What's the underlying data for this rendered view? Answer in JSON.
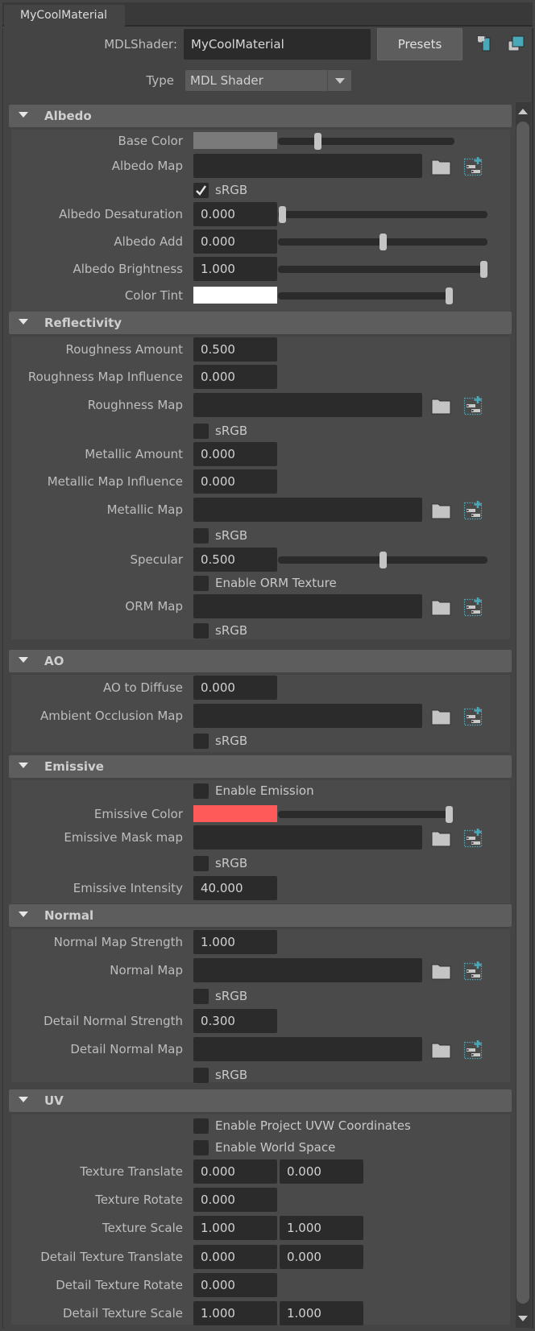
{
  "tab": {
    "label": "MyCoolMaterial"
  },
  "header": {
    "shader_label": "MDLShader:",
    "shader_name": "MyCoolMaterial",
    "presets_label": "Presets",
    "type_label": "Type",
    "type_value": "MDL Shader",
    "icons": [
      "show-input-output-icon",
      "copy-tab-icon"
    ]
  },
  "colors": {
    "accent": "#4aa9b8",
    "base_color": "#7a7a7a",
    "color_tint": "#ffffff",
    "emissive_color": "#ff5a5a"
  },
  "sections": {
    "albedo": {
      "title": "Albedo",
      "base_color": {
        "label": "Base Color",
        "slider": 0.21
      },
      "albedo_map": {
        "label": "Albedo Map",
        "value": ""
      },
      "albedo_srgb": {
        "label": "sRGB",
        "checked": true
      },
      "albedo_desaturation": {
        "label": "Albedo Desaturation",
        "value": "0.000",
        "slider": 0.0
      },
      "albedo_add": {
        "label": "Albedo Add",
        "value": "0.000",
        "slider": 0.5
      },
      "albedo_brightness": {
        "label": "Albedo Brightness",
        "value": "1.000",
        "slider": 1.0
      },
      "color_tint": {
        "label": "Color Tint",
        "slider": 1.0
      }
    },
    "reflectivity": {
      "title": "Reflectivity",
      "roughness_amount": {
        "label": "Roughness Amount",
        "value": "0.500"
      },
      "roughness_map_influence": {
        "label": "Roughness Map Influence",
        "value": "0.000"
      },
      "roughness_map": {
        "label": "Roughness Map",
        "value": ""
      },
      "roughness_srgb": {
        "label": "sRGB",
        "checked": false
      },
      "metallic_amount": {
        "label": "Metallic Amount",
        "value": "0.000"
      },
      "metallic_map_influence": {
        "label": "Metallic Map Influence",
        "value": "0.000"
      },
      "metallic_map": {
        "label": "Metallic Map",
        "value": ""
      },
      "metallic_srgb": {
        "label": "sRGB",
        "checked": false
      },
      "specular": {
        "label": "Specular",
        "value": "0.500",
        "slider": 0.5
      },
      "enable_orm": {
        "label": "Enable ORM Texture",
        "checked": false
      },
      "orm_map": {
        "label": "ORM Map",
        "value": ""
      },
      "orm_srgb": {
        "label": "sRGB",
        "checked": false
      }
    },
    "ao": {
      "title": "AO",
      "ao_to_diffuse": {
        "label": "AO to Diffuse",
        "value": "0.000"
      },
      "ao_map": {
        "label": "Ambient Occlusion Map",
        "value": ""
      },
      "ao_srgb": {
        "label": "sRGB",
        "checked": false
      }
    },
    "emissive": {
      "title": "Emissive",
      "enable_emission": {
        "label": "Enable Emission",
        "checked": false
      },
      "emissive_color": {
        "label": "Emissive Color",
        "slider": 1.0
      },
      "emissive_mask_map": {
        "label": "Emissive Mask map",
        "value": ""
      },
      "emissive_srgb": {
        "label": "sRGB",
        "checked": false
      },
      "emissive_intensity": {
        "label": "Emissive Intensity",
        "value": "40.000"
      }
    },
    "normal": {
      "title": "Normal",
      "normal_map_strength": {
        "label": "Normal Map Strength",
        "value": "1.000"
      },
      "normal_map": {
        "label": "Normal Map",
        "value": ""
      },
      "normal_srgb": {
        "label": "sRGB",
        "checked": false
      },
      "detail_normal_strength": {
        "label": "Detail Normal Strength",
        "value": "0.300"
      },
      "detail_normal_map": {
        "label": "Detail Normal Map",
        "value": ""
      },
      "detail_normal_srgb": {
        "label": "sRGB",
        "checked": false
      }
    },
    "uv": {
      "title": "UV",
      "enable_project_uvw": {
        "label": "Enable Project UVW Coordinates",
        "checked": false
      },
      "enable_world_space": {
        "label": "Enable World Space",
        "checked": false
      },
      "texture_translate": {
        "label": "Texture Translate",
        "values": [
          "0.000",
          "0.000"
        ]
      },
      "texture_rotate": {
        "label": "Texture Rotate",
        "value": "0.000"
      },
      "texture_scale": {
        "label": "Texture Scale",
        "values": [
          "1.000",
          "1.000"
        ]
      },
      "detail_texture_translate": {
        "label": "Detail Texture Translate",
        "values": [
          "0.000",
          "0.000"
        ]
      },
      "detail_texture_rotate": {
        "label": "Detail Texture Rotate",
        "value": "0.000"
      },
      "detail_texture_scale": {
        "label": "Detail Texture Scale",
        "values": [
          "1.000",
          "1.000"
        ]
      }
    }
  }
}
